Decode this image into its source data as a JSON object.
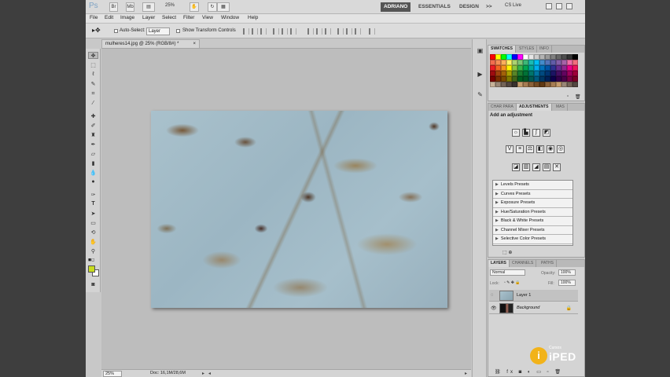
{
  "app": {
    "logo": "Ps",
    "zoom_level": "25%",
    "workspaces": [
      "ADRIANO",
      "ESSENTIALS",
      "DESIGN"
    ],
    "more": ">>",
    "cs_live": "CS Live",
    "bridge_btn": "Br",
    "mini_bridge_btn": "Mb"
  },
  "menu": [
    "File",
    "Edit",
    "Image",
    "Layer",
    "Select",
    "Filter",
    "View",
    "Window",
    "Help"
  ],
  "options": {
    "auto_select_label": "Auto-Select:",
    "auto_select_value": "Layer",
    "show_transform_label": "Show Transform Controls"
  },
  "document": {
    "tab_title": "mulheres14.jpg @ 25% (RGB/8#) *",
    "close": "×"
  },
  "status": {
    "zoom": "25%",
    "doc_info": "Doc: 16,1M/28,6M"
  },
  "colors": {
    "foreground": "#c8dc1e",
    "background": "#ffffff"
  },
  "swatches_panel": {
    "tabs": [
      "SWATCHES",
      "STYLES",
      "INFO"
    ]
  },
  "swatches": [
    "#ff0000",
    "#ffff00",
    "#00ff00",
    "#00ffff",
    "#0000ff",
    "#ff00ff",
    "#ffffff",
    "#e6e6e6",
    "#cccccc",
    "#b3b3b3",
    "#999999",
    "#808080",
    "#666666",
    "#4d4d4d",
    "#333333",
    "#000000",
    "#f26c4f",
    "#f68e55",
    "#fbaf5c",
    "#fff467",
    "#acd372",
    "#7cc576",
    "#3bb878",
    "#1abbb4",
    "#00bff3",
    "#438ccb",
    "#5574b9",
    "#605ca8",
    "#855fa8",
    "#a763a8",
    "#f06ea9",
    "#f26d7d",
    "#ed1c24",
    "#f26522",
    "#f7941d",
    "#fff200",
    "#8dc73f",
    "#39b54a",
    "#00a651",
    "#00a99d",
    "#00aeef",
    "#0072bc",
    "#0054a6",
    "#2e3192",
    "#662d91",
    "#92278f",
    "#ec008c",
    "#ed145b",
    "#9e0b0f",
    "#a0410d",
    "#a36209",
    "#aba000",
    "#598527",
    "#197b30",
    "#007236",
    "#00746b",
    "#0076a3",
    "#004a80",
    "#003471",
    "#1b1464",
    "#440e62",
    "#630460",
    "#9e005d",
    "#9e0039",
    "#790000",
    "#7b2e00",
    "#7d4900",
    "#827b00",
    "#406618",
    "#005e20",
    "#005826",
    "#005952",
    "#005b7f",
    "#003663",
    "#002157",
    "#0d004c",
    "#32004b",
    "#4b0049",
    "#7b0046",
    "#7a0026",
    "#c7b299",
    "#998675",
    "#736357",
    "#534741",
    "#37302d",
    "#c69c6d",
    "#a67c52",
    "#8c6239",
    "#754c24",
    "#603913",
    "#8c6239",
    "#a67c52",
    "#c69c6d",
    "#998675",
    "#736357",
    "#534741"
  ],
  "adjustments_panel": {
    "tabs": [
      "CHAR PARA",
      "ADJUSTMENTS",
      "MAS"
    ],
    "title": "Add an adjustment",
    "presets": [
      "Levels Presets",
      "Curves Presets",
      "Exposure Presets",
      "Hue/Saturation Presets",
      "Black & White Presets",
      "Channel Mixer Presets",
      "Selective Color Presets"
    ]
  },
  "layers_panel": {
    "tabs": [
      "LAYERS",
      "CHANNELS",
      "PATHS"
    ],
    "blend_mode": "Normal",
    "opacity_label": "Opacity:",
    "opacity_value": "100%",
    "lock_label": "Lock:",
    "fill_label": "Fill:",
    "fill_value": "100%",
    "layers": [
      {
        "name": "Layer 1",
        "selected": true
      },
      {
        "name": "Background",
        "selected": false
      }
    ]
  },
  "watermark": {
    "small": "Cursos",
    "big": "iPED",
    "i": "i"
  }
}
